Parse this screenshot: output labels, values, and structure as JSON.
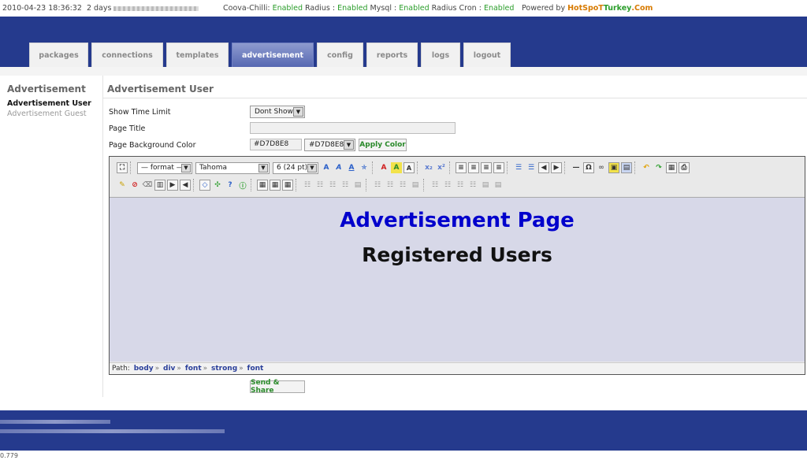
{
  "topbar": {
    "datetime": "2010-04-23 18:36:32",
    "uptime": "2 days",
    "status_prefix": "Coova-Chilli:",
    "chilli_status": "Enabled",
    "radius_label": "Radius :",
    "radius_status": "Enabled",
    "mysql_label": "Mysql :",
    "mysql_status": "Enabled",
    "cron_label": "Radius Cron :",
    "cron_status": "Enabled",
    "powered_label": "Powered by",
    "brand_a": "HotSpoT",
    "brand_b": "Turkey",
    "brand_c": ".Com"
  },
  "tabs": [
    {
      "label": "packages"
    },
    {
      "label": "connections"
    },
    {
      "label": "templates"
    },
    {
      "label": "advertisement"
    },
    {
      "label": "config"
    },
    {
      "label": "reports"
    },
    {
      "label": "logs"
    },
    {
      "label": "logout"
    }
  ],
  "sidebar": {
    "heading": "Advertisement",
    "items": [
      {
        "label": "Advertisement User"
      },
      {
        "label": "Advertisement Guest"
      }
    ]
  },
  "main": {
    "title": "Advertisement User",
    "show_time_limit_label": "Show Time Limit",
    "show_time_limit_value": "Dont Show",
    "page_title_label": "Page Title",
    "page_title_value": "",
    "bg_color_label": "Page Background Color",
    "bg_color_input": "#D7D8E8",
    "bg_color_select": "#D7D8E8",
    "apply_color_label": "Apply Color",
    "send_share_label": "Send & Share"
  },
  "editor": {
    "format_select": "— format —",
    "font_select": "Tahoma",
    "size_select": "6 (24 pt)",
    "content_title": "Advertisement Page",
    "content_subtitle": "Registered Users",
    "content_title_color": "#0000cc",
    "background_color": "#D7D8E8",
    "path_label": "Path:",
    "path": [
      "body",
      "div",
      "font",
      "strong",
      "font"
    ]
  },
  "footer": {
    "version": "0.779"
  },
  "colors": {
    "header_blue": "#253a8d",
    "enabled_green": "#2a9d2a",
    "brand_orange": "#d77a00"
  }
}
